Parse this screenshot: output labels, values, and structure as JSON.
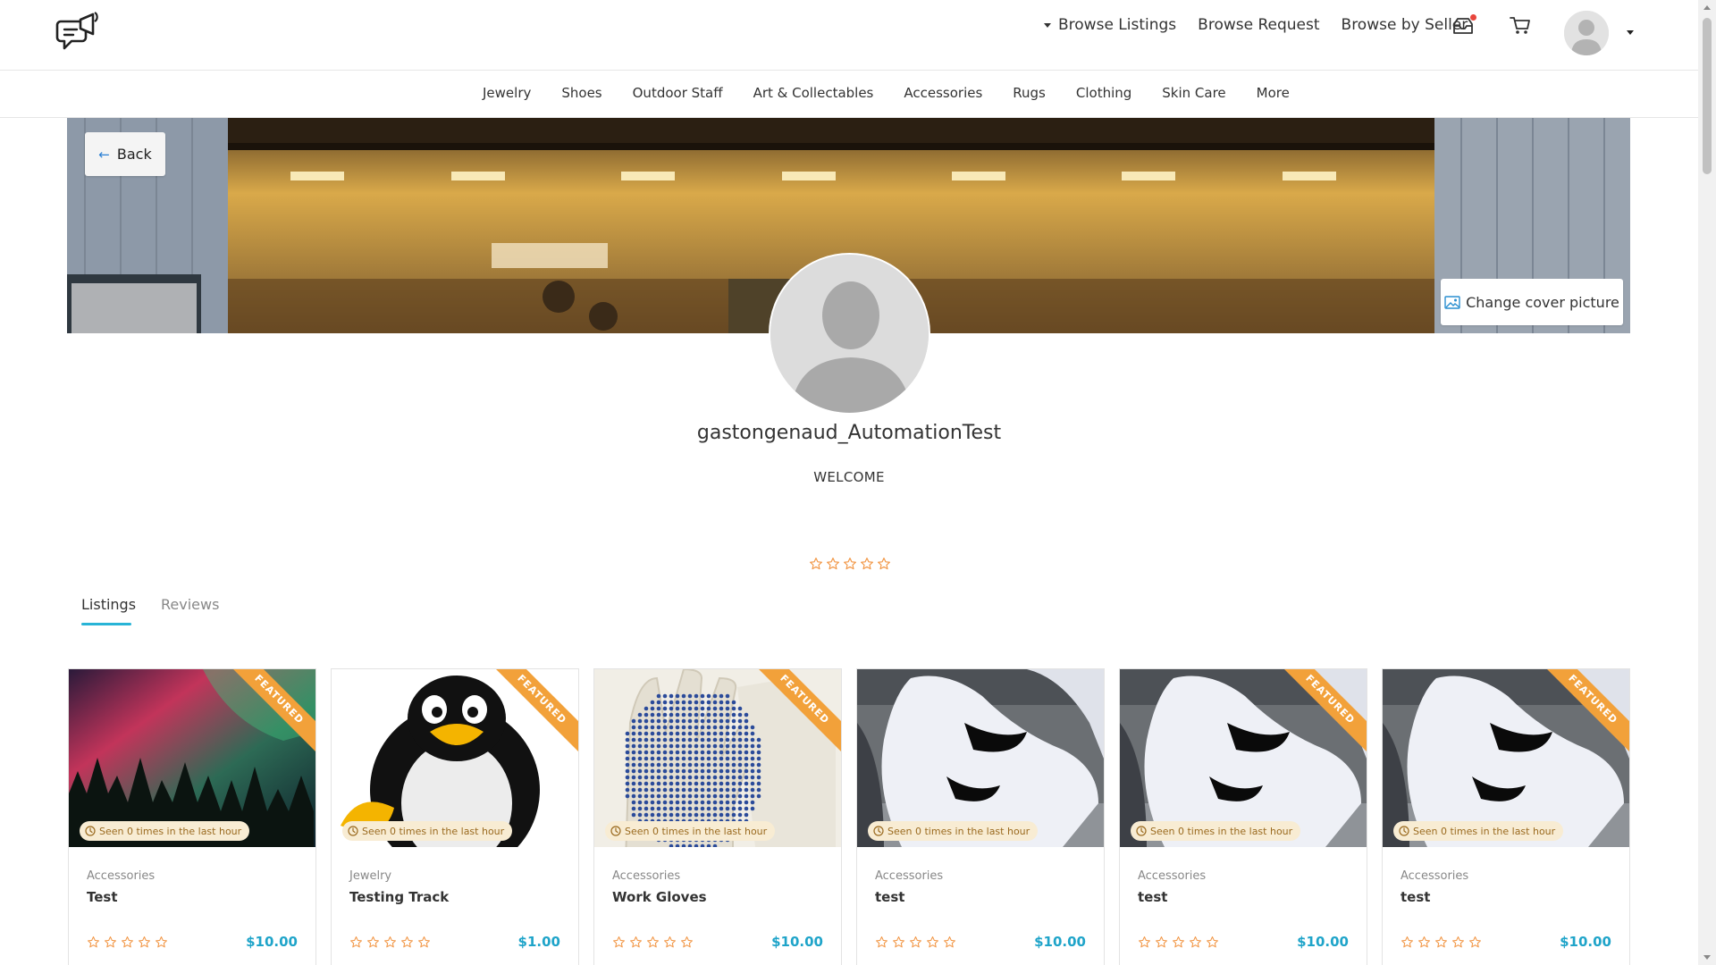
{
  "header": {
    "nav": {
      "browse_listings": "Browse Listings",
      "browse_request": "Browse Request",
      "browse_by_seller": "Browse by Seller"
    },
    "icons": {
      "logo": "chat-megaphone-logo-icon",
      "messages": "inbox-icon",
      "cart": "cart-icon",
      "user": "avatar-icon"
    },
    "notification_color": "#e8453c"
  },
  "categories": [
    "Jewelry",
    "Shoes",
    "Outdoor Staff",
    "Art & Collectables",
    "Accessories",
    "Rugs",
    "Clothing",
    "Skin Care",
    "More"
  ],
  "cover": {
    "back_label": "Back",
    "change_cover_label": "Change cover picture"
  },
  "profile": {
    "username": "gastongenaud_AutomationTest",
    "welcome": "WELCOME",
    "rating": 0
  },
  "tabs": {
    "listings": "Listings",
    "reviews": "Reviews"
  },
  "colors": {
    "accent": "#28b4d7",
    "price": "#1fa4c9",
    "featured": "#f2a13a",
    "star": "#f2994a"
  },
  "listings": [
    {
      "category": "Accessories",
      "title": "Test",
      "price": "$10.00",
      "badge": "FEATURED",
      "seen": "Seen 0 times in the last hour",
      "rating": 0,
      "image": "aurora-forest"
    },
    {
      "category": "Jewelry",
      "title": "Testing Track",
      "price": "$1.00",
      "badge": "FEATURED",
      "seen": "Seen 0 times in the last hour",
      "rating": 0,
      "image": "penguin"
    },
    {
      "category": "Accessories",
      "title": "Work Gloves",
      "price": "$10.00",
      "badge": "FEATURED",
      "seen": "Seen 0 times in the last hour",
      "rating": 0,
      "image": "gloves"
    },
    {
      "category": "Accessories",
      "title": "test",
      "price": "$10.00",
      "badge": "",
      "seen": "Seen 0 times in the last hour",
      "rating": 0,
      "image": "sneakers"
    },
    {
      "category": "Accessories",
      "title": "test",
      "price": "$10.00",
      "badge": "FEATURED",
      "seen": "Seen 0 times in the last hour",
      "rating": 0,
      "image": "sneakers"
    },
    {
      "category": "Accessories",
      "title": "test",
      "price": "$10.00",
      "badge": "FEATURED",
      "seen": "Seen 0 times in the last hour",
      "rating": 0,
      "image": "sneakers"
    }
  ]
}
